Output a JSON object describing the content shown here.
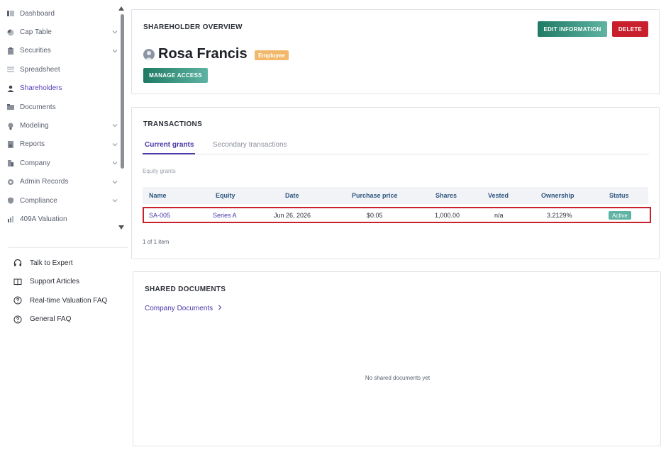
{
  "sidebar": {
    "items": [
      {
        "label": "Dashboard",
        "icon": "dashboard-icon",
        "has_chevron": false
      },
      {
        "label": "Cap Table",
        "icon": "pie-chart-icon",
        "has_chevron": true
      },
      {
        "label": "Securities",
        "icon": "clipboard-icon",
        "has_chevron": true
      },
      {
        "label": "Spreadsheet",
        "icon": "spreadsheet-icon",
        "has_chevron": false
      },
      {
        "label": "Shareholders",
        "icon": "person-icon",
        "has_chevron": false,
        "active": true
      },
      {
        "label": "Documents",
        "icon": "folder-icon",
        "has_chevron": false
      },
      {
        "label": "Modeling",
        "icon": "lightbulb-icon",
        "has_chevron": true
      },
      {
        "label": "Reports",
        "icon": "report-icon",
        "has_chevron": true
      },
      {
        "label": "Company",
        "icon": "building-icon",
        "has_chevron": true
      },
      {
        "label": "Admin Records",
        "icon": "gear-icon",
        "has_chevron": true
      },
      {
        "label": "Compliance",
        "icon": "shield-icon",
        "has_chevron": true
      },
      {
        "label": "409A Valuation",
        "icon": "bar-chart-icon",
        "has_chevron": false
      }
    ],
    "help": [
      {
        "label": "Talk to Expert",
        "icon": "headphones-icon"
      },
      {
        "label": "Support Articles",
        "icon": "book-icon"
      },
      {
        "label": "Real-time Valuation FAQ",
        "icon": "question-circle-icon"
      },
      {
        "label": "General FAQ",
        "icon": "question-circle-icon"
      }
    ]
  },
  "overview": {
    "title": "SHAREHOLDER OVERVIEW",
    "name": "Rosa Francis",
    "role_badge": "Employee",
    "edit_label": "EDIT INFORMATION",
    "delete_label": "DELETE",
    "manage_label": "MANAGE ACCESS"
  },
  "transactions": {
    "title": "TRANSACTIONS",
    "tabs": [
      "Current grants",
      "Secondary transactions"
    ],
    "subheading": "Equity grants",
    "columns": [
      "Name",
      "Equity",
      "Date",
      "Purchase price",
      "Shares",
      "Vested",
      "Ownership",
      "Status"
    ],
    "rows": [
      {
        "name": "SA-005",
        "equity": "Series A",
        "date": "Jun 26, 2026",
        "price": "$0.05",
        "shares": "1,000.00",
        "vested": "n/a",
        "ownership": "3.2129%",
        "status": "Active"
      }
    ],
    "pager": "1 of 1 item"
  },
  "documents": {
    "title": "SHARED DOCUMENTS",
    "link_label": "Company Documents",
    "empty_message": "No shared documents yet"
  },
  "colors": {
    "accent": "#4a37a8",
    "teal": "#1f7a63",
    "danger": "#c8202d",
    "employee_badge": "#f2b86a"
  }
}
